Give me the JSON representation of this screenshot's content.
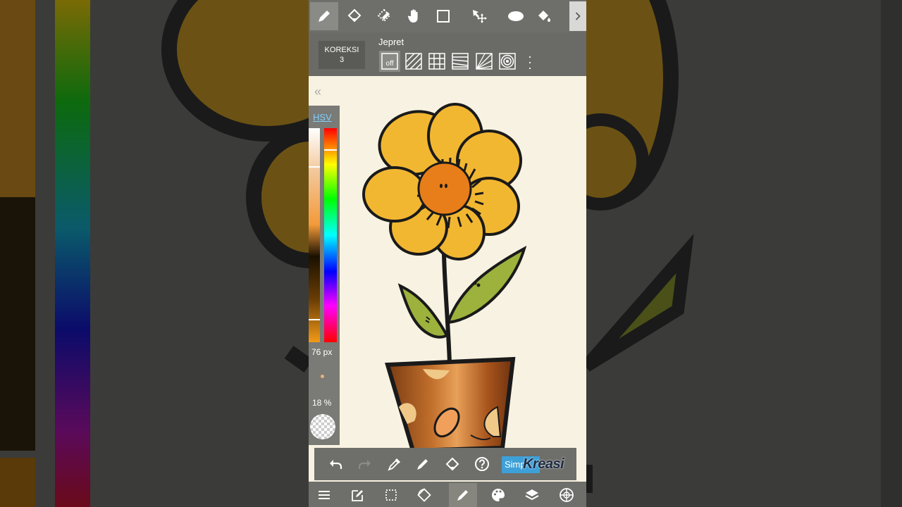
{
  "toolbar": {
    "tools": [
      "pen-icon",
      "eraser-icon",
      "selection-eraser-icon",
      "hand-icon",
      "rectangle-icon",
      "move-icon",
      "ellipse-icon",
      "fill-bucket-icon"
    ],
    "active": "pen-icon"
  },
  "subbar": {
    "correction_label": "KOREKSI",
    "correction_value": "3",
    "snap_label": "Jepret",
    "snap_off_label": "off",
    "snaps": [
      "snap-off-icon",
      "snap-parallel-icon",
      "snap-grid-icon",
      "snap-horizontal-icon",
      "snap-perspective-icon",
      "snap-circle-icon"
    ]
  },
  "color_panel": {
    "mode_label": "HSV",
    "brush_size": "76 px",
    "opacity": "18 %",
    "current_color": "#f39c16"
  },
  "quick_bar": {
    "simple_label": "Simp",
    "watermark": "Kreasi"
  },
  "bottom_bar": {
    "items": [
      "menu-icon",
      "edit-icon",
      "selection-icon",
      "rotate-canvas-icon",
      "brush-icon",
      "palette-icon",
      "layers-icon",
      "material-icon"
    ],
    "active": "brush-icon"
  }
}
